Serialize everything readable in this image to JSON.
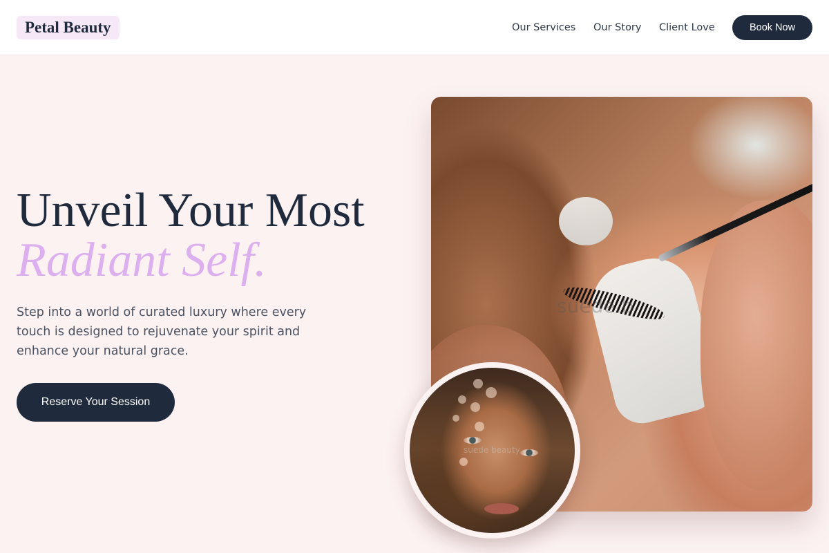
{
  "brand": {
    "name": "Petal Beauty"
  },
  "nav": {
    "items": [
      {
        "label": "Our Services"
      },
      {
        "label": "Our Story"
      },
      {
        "label": "Client Love"
      }
    ],
    "cta_label": "Book Now"
  },
  "hero": {
    "headline": "Unveil Your Most",
    "headline_accent": "Radiant Self.",
    "tagline": "Step into a world of curated luxury where every touch is designed to rejuvenate your spirit and enhance your natural grace.",
    "cta_label": "Reserve Your Session"
  },
  "images": {
    "main_photo": {
      "subject": "lash-extension-treatment",
      "watermark": "suede.b"
    },
    "circle_photo": {
      "subject": "portrait-woman-face",
      "watermark": "suede beauty"
    }
  },
  "colors": {
    "primary_dark": "#1f2a3d",
    "accent_lavender": "#dcb0ee",
    "background_blush": "#fdf2f2",
    "logo_bg": "#f7e8f8"
  }
}
